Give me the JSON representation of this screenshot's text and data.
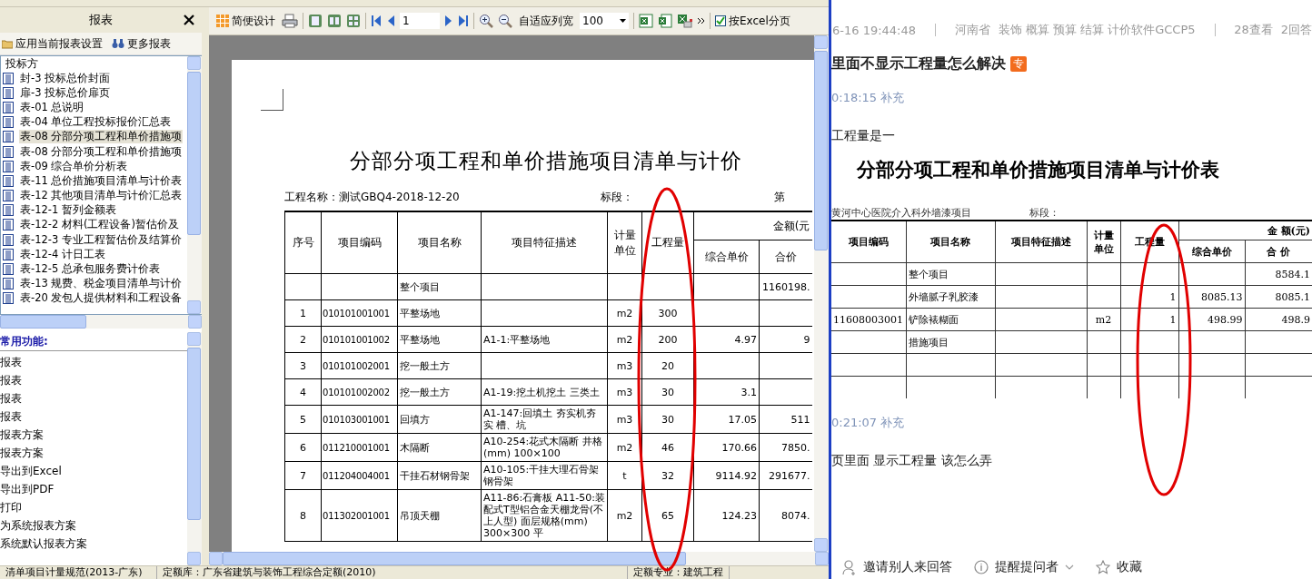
{
  "left_panel": {
    "title": "报表",
    "apply_settings": "应用当前报表设置",
    "more_reports": "更多报表",
    "tree": {
      "root": "投标方",
      "items": [
        {
          "label": "封-3 投标总价封面",
          "selected": false
        },
        {
          "label": "扉-3 投标总价扉页",
          "selected": false
        },
        {
          "label": "表-01 总说明",
          "selected": false
        },
        {
          "label": "表-04 单位工程投标报价汇总表",
          "selected": false
        },
        {
          "label": "表-08 分部分项工程和单价措施项",
          "selected": true
        },
        {
          "label": "表-08 分部分项工程和单价措施项",
          "selected": false
        },
        {
          "label": "表-09 综合单价分析表",
          "selected": false
        },
        {
          "label": "表-11 总价措施项目清单与计价表",
          "selected": false
        },
        {
          "label": "表-12 其他项目清单与计价汇总表",
          "selected": false
        },
        {
          "label": "表-12-1 暂列金额表",
          "selected": false
        },
        {
          "label": "表-12-2 材料(工程设备)暂估价及",
          "selected": false
        },
        {
          "label": "表-12-3 专业工程暂估价及结算价",
          "selected": false
        },
        {
          "label": "表-12-4 计日工表",
          "selected": false
        },
        {
          "label": "表-12-5 总承包服务费计价表",
          "selected": false
        },
        {
          "label": "表-13 规费、税金项目清单与计价",
          "selected": false
        },
        {
          "label": "表-20 发包人提供材料和工程设备",
          "selected": false
        }
      ]
    },
    "functions": {
      "title": "常用功能:",
      "items": [
        "报表",
        "报表",
        "报表",
        "报表",
        "报表方案",
        "报表方案",
        "导出到Excel",
        "导出到PDF",
        "打印",
        "为系统报表方案",
        "系统默认报表方案"
      ]
    }
  },
  "toolbar": {
    "simple_design": "简便设计",
    "page": "1",
    "fit_columns": "自适应列宽",
    "zoom": "100",
    "excel_paging": {
      "label": "按Excel分页",
      "checked": true
    }
  },
  "report": {
    "title": "分部分项工程和单价措施项目清单与计价",
    "project": "工程名称：测试GBQ4-2018-12-20",
    "section": "标段：",
    "page": "第",
    "amount_header": "金额(元",
    "columns": [
      "序号",
      "项目编码",
      "项目名称",
      "项目特征描述",
      "计量单位",
      "工程量",
      "综合单价",
      "合价"
    ],
    "rows": [
      {
        "name": "整个项目",
        "total": "1160198."
      },
      {
        "no": "1",
        "code": "010101001001",
        "name": "平整场地",
        "unit": "m2",
        "qty": "300"
      },
      {
        "no": "2",
        "code": "010101001002",
        "name": "平整场地",
        "desc": "A1-1:平整场地",
        "unit": "m2",
        "qty": "200",
        "price": "4.97",
        "total": "9"
      },
      {
        "no": "3",
        "code": "010101002001",
        "name": "挖一般土方",
        "unit": "m3",
        "qty": "20"
      },
      {
        "no": "4",
        "code": "010101002002",
        "name": "挖一般土方",
        "desc": "A1-19:挖土机挖土 三类土",
        "unit": "m3",
        "qty": "30",
        "price": "3.1"
      },
      {
        "no": "5",
        "code": "010103001001",
        "name": "回填方",
        "desc": "A1-147:回填土 夯实机夯实 槽、坑",
        "unit": "m3",
        "qty": "30",
        "price": "17.05",
        "total": "511"
      },
      {
        "no": "6",
        "code": "011210001001",
        "name": "木隔断",
        "desc": "A10-254:花式木隔断 井格(mm) 100×100",
        "unit": "m2",
        "qty": "46",
        "price": "170.66",
        "total": "7850."
      },
      {
        "no": "7",
        "code": "011204004001",
        "name": "干挂石材钢骨架",
        "desc": "A10-105:干挂大理石骨架钢骨架",
        "unit": "t",
        "qty": "32",
        "price": "9114.92",
        "total": "291677."
      },
      {
        "no": "8",
        "code": "011302001001",
        "name": "吊顶天棚",
        "desc": "A11-86:石膏板 A11-50:装配式T型铝合金天棚龙骨(不上人型) 面层规格(mm) 300×300 平",
        "unit": "m2",
        "qty": "65",
        "price": "124.23",
        "total": "8074."
      }
    ]
  },
  "status_bar": [
    "清单项目计量规范(2013-广东)",
    "定额库：广东省建筑与装饰工程综合定额(2010)",
    "定额专业：建筑工程"
  ],
  "post": {
    "meta": {
      "time": "6-16 19:44:48",
      "region": "河南省",
      "tags": "装饰 概算 预算 结算 计价软件GCCP5",
      "views": "28查看",
      "answers": "2回答"
    },
    "title": "里面不显示工程量怎么解决",
    "badge": "专",
    "supplements": [
      {
        "time": "0:18:15 补充",
        "text": "工程量是一",
        "image": {
          "title": "分部分项工程和单价措施项目清单与计价表",
          "project": "黄河中心医院介入科外墙漆项目",
          "section": "标段：",
          "amount_header": "金 额(元)",
          "columns": [
            "项目编码",
            "项目名称",
            "项目特征描述",
            "计量单位",
            "工程量",
            "综合单价",
            "合 价"
          ],
          "rows": [
            {
              "name": "整个项目",
              "total": "8584.1"
            },
            {
              "name": "外墙腻子乳胶漆",
              "qty": "1",
              "price": "8085.13",
              "total": "8085.1"
            },
            {
              "code": "11608003001",
              "name": "铲除裱糊面",
              "unit": "m2",
              "qty": "1",
              "price": "498.99",
              "total": "498.9"
            },
            {
              "name": "措施项目"
            }
          ]
        }
      },
      {
        "time": "0:21:07 补充",
        "text": "页里面 显示工程量 该怎么弄"
      }
    ],
    "actions": [
      {
        "kind": "invite",
        "label": "邀请别人来回答"
      },
      {
        "kind": "remind",
        "label": "提醒提问者"
      },
      {
        "kind": "favorite",
        "label": "收藏"
      }
    ]
  }
}
